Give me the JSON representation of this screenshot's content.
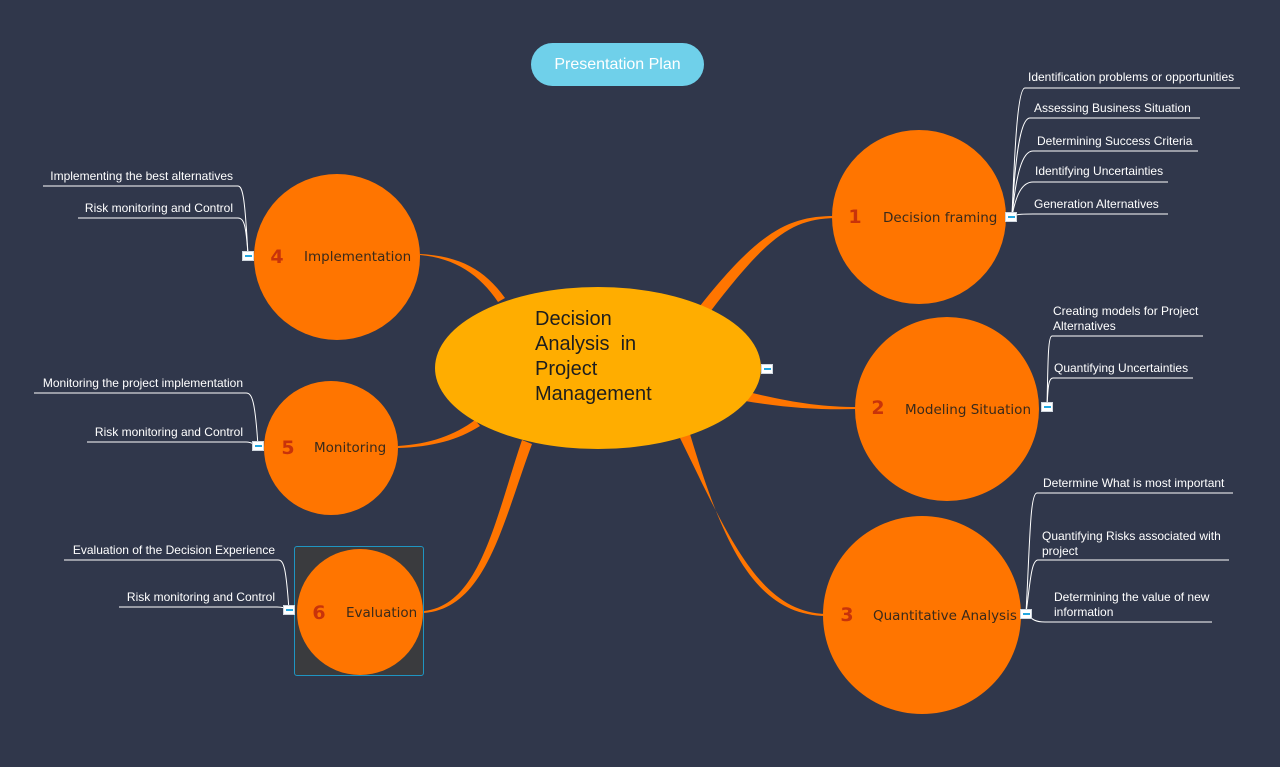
{
  "title": "Presentation Plan",
  "central_topic": {
    "lines": [
      "Decision",
      "Analysis  in",
      "Project",
      "Management"
    ],
    "color": "#ffad00"
  },
  "colors": {
    "background": "#30374b",
    "topic_fill": "#ff7500",
    "connector": "#ff7500",
    "number_badge": "#c8330a",
    "subtopic_line": "#ffffff",
    "title_pill": "#6fd0ea",
    "selection": "#1f95c2"
  },
  "topics": [
    {
      "number": "1",
      "label": "Decision framing",
      "side": "right",
      "subtopics": [
        "Identification problems or opportunities",
        "Assessing Business Situation",
        "Determining Success Criteria",
        "Identifying Uncertainties",
        "Generation Alternatives"
      ]
    },
    {
      "number": "2",
      "label": "Modeling Situation",
      "side": "right",
      "subtopics": [
        "Creating models for Project\nAlternatives",
        "Quantifying Uncertainties"
      ]
    },
    {
      "number": "3",
      "label": "Quantitative Analysis",
      "side": "right",
      "subtopics": [
        "Determine What is most important",
        "Quantifying Risks associated with\nproject",
        "Determining the value of new\ninformation"
      ]
    },
    {
      "number": "4",
      "label": "Implementation",
      "side": "left",
      "subtopics": [
        "Implementing the best alternatives",
        "Risk monitoring and Control"
      ]
    },
    {
      "number": "5",
      "label": "Monitoring",
      "side": "left",
      "subtopics": [
        "Monitoring the project implementation",
        "Risk monitoring and Control"
      ]
    },
    {
      "number": "6",
      "label": "Evaluation",
      "side": "left",
      "selected": true,
      "subtopics": [
        "Evaluation of the Decision Experience",
        "Risk monitoring and Control"
      ]
    }
  ],
  "icons": {
    "collapse": "collapse-minus-icon"
  }
}
